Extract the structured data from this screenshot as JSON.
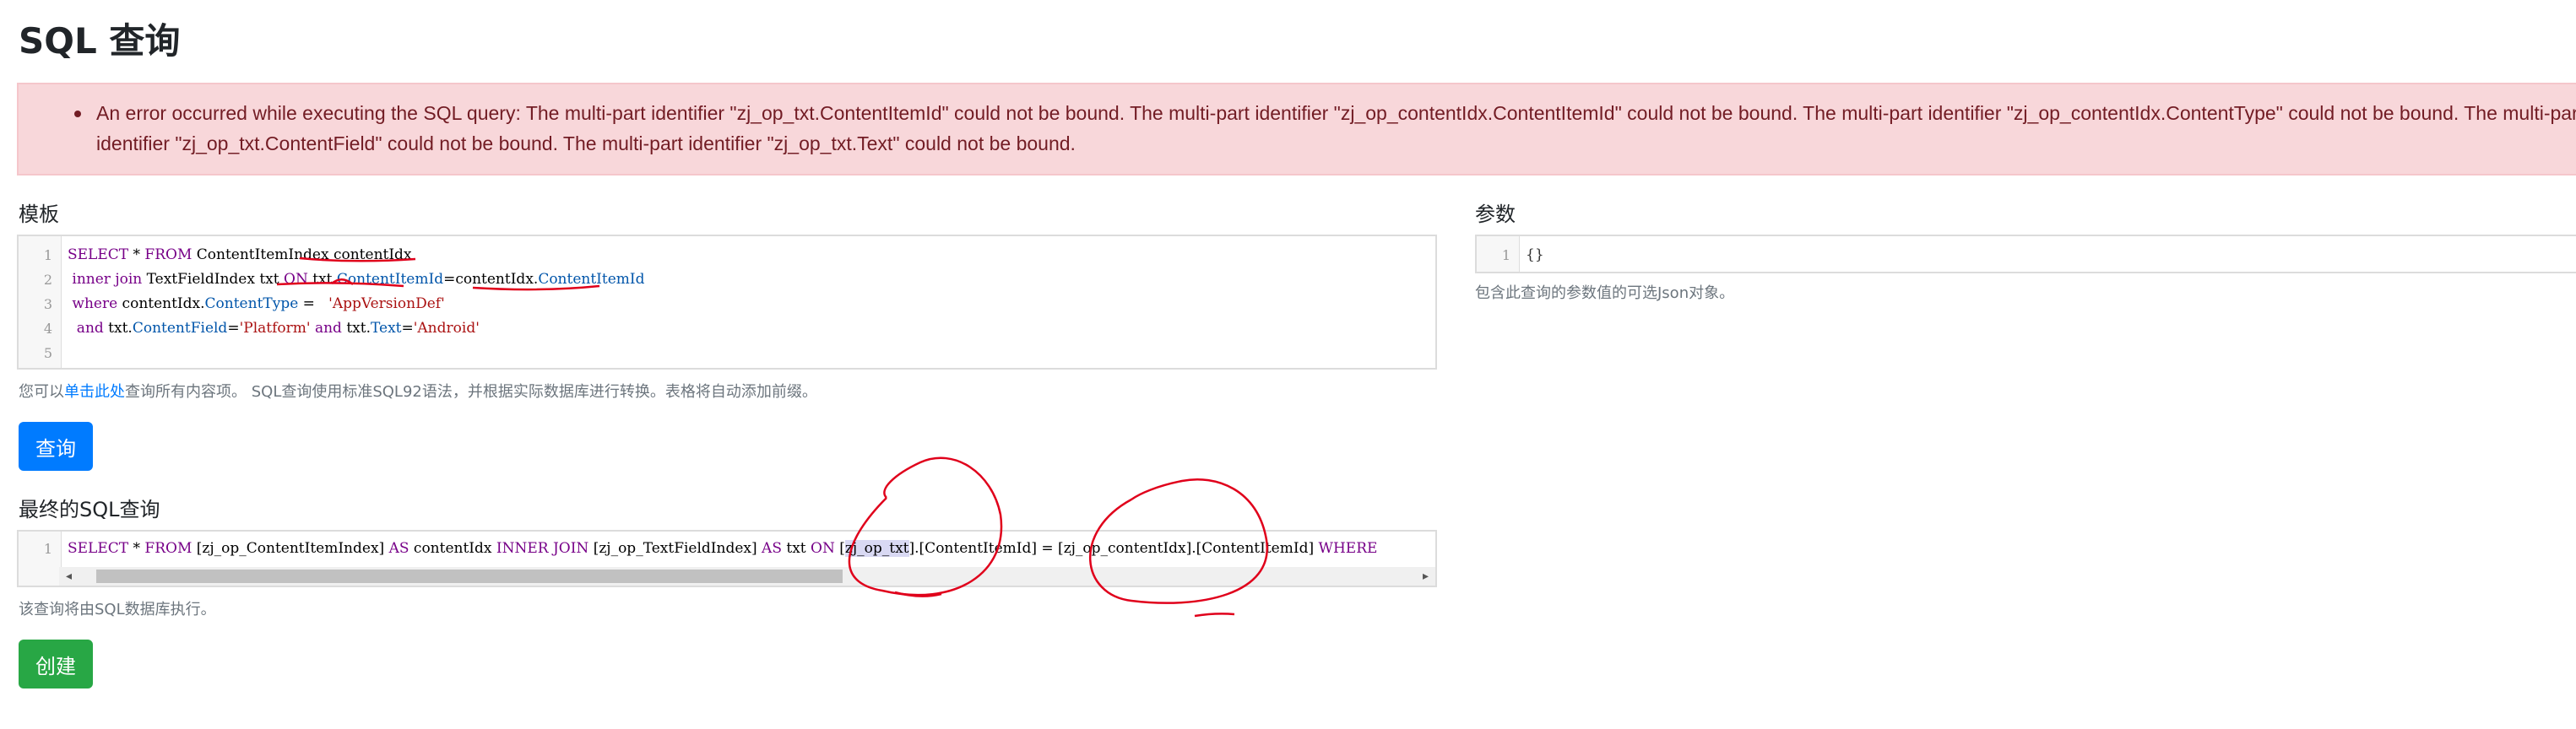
{
  "page": {
    "title": "SQL 查询"
  },
  "error": {
    "message": "An error occurred while executing the SQL query: The multi-part identifier \"zj_op_txt.ContentItemId\" could not be bound. The multi-part identifier \"zj_op_contentIdx.ContentItemId\" could not be bound. The multi-part identifier \"zj_op_contentIdx.ContentType\" could not be bound. The multi-part identifier \"zj_op_txt.ContentField\" could not be bound. The multi-part identifier \"zj_op_txt.Text\" could not be bound."
  },
  "template_section": {
    "label": "模板",
    "line_numbers": [
      "1",
      "2",
      "3",
      "4",
      "5"
    ],
    "hint_prefix": "您可以",
    "hint_link": "单击此处",
    "hint_suffix": "查询所有内容项。 SQL查询使用标准SQL92语法，并根据实际数据库进行转换。表格将自动添加前缀。"
  },
  "code": {
    "l1_kw1": "SELECT",
    "l1_star": " * ",
    "l1_kw2": "FROM",
    "l1_rest": " ContentItemIndex contentIdx",
    "l2_kw1": " inner join",
    "l2_mid": " TextFieldIndex txt ",
    "l2_kw2": "ON",
    "l2_obj": " txt.",
    "l2_prop1": "ContentItemId",
    "l2_eq": "=contentIdx.",
    "l2_prop2": "ContentItemId",
    "l3_kw": " where",
    "l3_obj": " contentIdx.",
    "l3_prop": "ContentType",
    "l3_eq": " =   ",
    "l3_str": "'AppVersionDef'",
    "l4_kw": "  and",
    "l4_obj": " txt.",
    "l4_prop": "ContentField",
    "l4_eq": "=",
    "l4_str": "'Platform'",
    "l4_kw2": " and",
    "l4_obj2": " txt.",
    "l4_prop2": "Text",
    "l4_eq2": "=",
    "l4_str2": "'Android'"
  },
  "params_section": {
    "label": "参数",
    "line_number": "1",
    "value": "{}",
    "hint": "包含此查询的参数值的可选Json对象。"
  },
  "query_button": {
    "label": "查询"
  },
  "final_section": {
    "label": "最终的SQL查询",
    "line_number": "1",
    "kw1": "SELECT",
    "p1": " * ",
    "kw2": "FROM",
    "p2": " [zj_op_ContentItemIndex] ",
    "kw3": "AS",
    "p3": " contentIdx ",
    "kw4": "INNER JOIN",
    "p4": " [zj_op_TextFieldIndex] ",
    "kw5": "AS",
    "p5": " txt ",
    "kw6": "ON",
    "p6": " [",
    "hl": "zj_op_txt",
    "p7": "].[ContentItemId] = [zj_op_contentIdx].[ContentItemId] ",
    "kw7": "WHERE",
    "scroll_left": "◂",
    "scroll_right": "▸",
    "hint": "该查询将由SQL数据库执行。"
  },
  "create_button": {
    "label": "创建"
  },
  "colors": {
    "annotation": "#e0001b",
    "primary": "#007bff",
    "success": "#28a745",
    "alert_bg": "#f8d7da",
    "alert_text": "#721c24"
  }
}
